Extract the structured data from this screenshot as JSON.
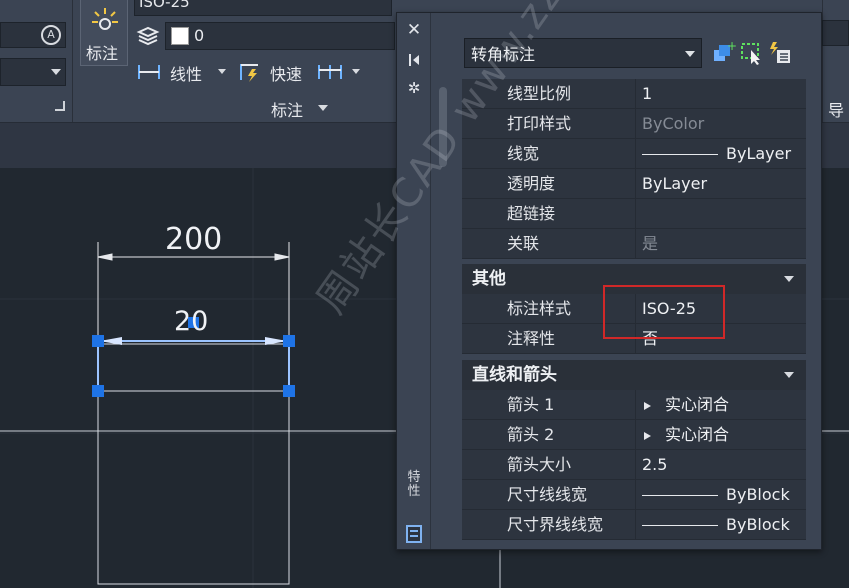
{
  "ribbon": {
    "dim_style_value": "ISO-25",
    "dim_panel_label": "标注",
    "layer_value": "0",
    "linear_label": "线性",
    "quick_label": "快速",
    "dimension_group_label": "标注",
    "right_edge_label": "导"
  },
  "drawing": {
    "dim_top": "200",
    "dim_selected": "20"
  },
  "palette": {
    "title": "特性",
    "object_type": "转角标注",
    "rows_top": [
      {
        "name": "线型比例",
        "value": "1"
      },
      {
        "name": "打印样式",
        "value": "ByColor"
      },
      {
        "name": "线宽",
        "value": "ByLayer"
      },
      {
        "name": "透明度",
        "value": "ByLayer"
      },
      {
        "name": "超链接",
        "value": ""
      },
      {
        "name": "关联",
        "value": "是"
      }
    ],
    "category_other": "其他",
    "rows_other": [
      {
        "name": "标注样式",
        "value": "ISO-25"
      },
      {
        "name": "注释性",
        "value": "否"
      }
    ],
    "category_lines": "直线和箭头",
    "rows_lines": [
      {
        "name": "箭头 1",
        "value": "实心闭合"
      },
      {
        "name": "箭头 2",
        "value": "实心闭合"
      },
      {
        "name": "箭头大小",
        "value": "2.5"
      },
      {
        "name": "尺寸线线宽",
        "value": "ByBlock"
      },
      {
        "name": "尺寸界线线宽",
        "value": "ByBlock"
      }
    ]
  },
  "watermark": "周站长CAD www.zzzcad.com",
  "colors": {
    "selection_blue": "#1e73e6",
    "highlight_red": "#d02828"
  }
}
